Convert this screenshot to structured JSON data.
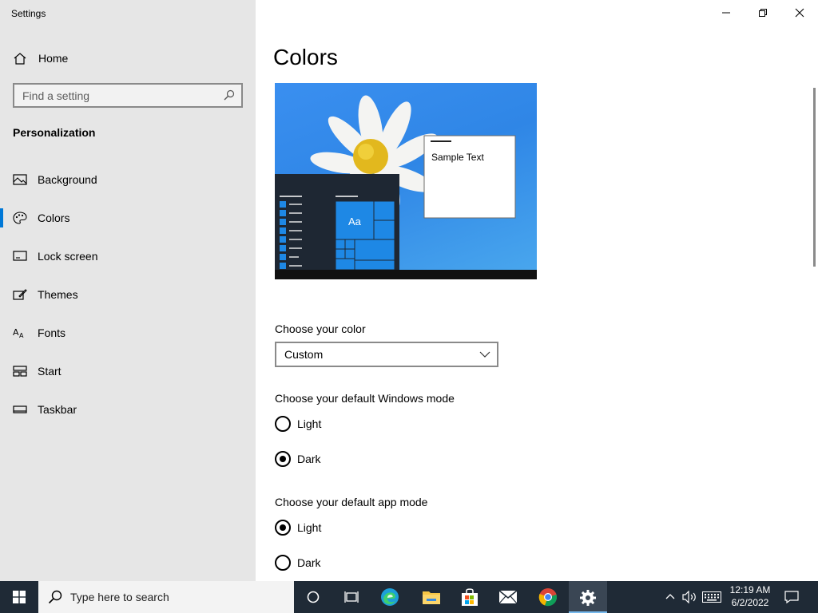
{
  "window": {
    "title": "Settings"
  },
  "sidebar": {
    "home_label": "Home",
    "search_placeholder": "Find a setting",
    "section_title": "Personalization",
    "items": [
      {
        "label": "Background",
        "icon": "picture-icon"
      },
      {
        "label": "Colors",
        "icon": "palette-icon",
        "active": true
      },
      {
        "label": "Lock screen",
        "icon": "lock-screen-icon"
      },
      {
        "label": "Themes",
        "icon": "brush-icon"
      },
      {
        "label": "Fonts",
        "icon": "fonts-icon"
      },
      {
        "label": "Start",
        "icon": "start-layout-icon"
      },
      {
        "label": "Taskbar",
        "icon": "taskbar-icon"
      }
    ]
  },
  "main": {
    "title": "Colors",
    "preview": {
      "sample_text": "Sample Text",
      "tile_label": "Aa"
    },
    "color": {
      "label": "Choose your color",
      "selected": "Custom"
    },
    "windows_mode": {
      "label": "Choose your default Windows mode",
      "options": [
        {
          "label": "Light",
          "selected": false
        },
        {
          "label": "Dark",
          "selected": true
        }
      ]
    },
    "app_mode": {
      "label": "Choose your default app mode",
      "options": [
        {
          "label": "Light",
          "selected": true
        },
        {
          "label": "Dark",
          "selected": false
        }
      ]
    }
  },
  "taskbar": {
    "search_placeholder": "Type here to search",
    "time": "12:19 AM",
    "date": "6/2/2022"
  },
  "colors": {
    "accent": "#0078d7",
    "sidebar_bg": "#e6e6e6",
    "taskbar_bg": "#1f2a36"
  }
}
